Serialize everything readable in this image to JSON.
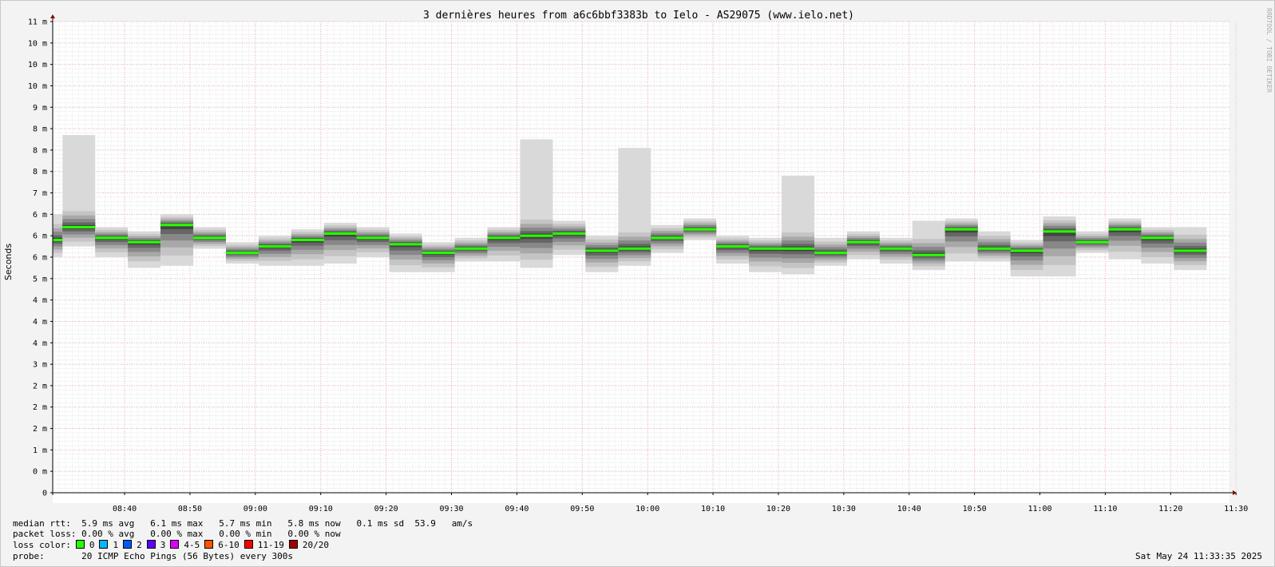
{
  "chart_data": {
    "type": "bar",
    "title": "3 dernières heures from a6c6bbf3383b to Ielo - AS29075 (www.ielo.net)",
    "ylabel": "Seconds",
    "xlabel": "",
    "y_unit": "ms",
    "ylim": [
      0,
      11
    ],
    "y_ticks": [
      {
        "v": 0,
        "label": "0"
      },
      {
        "v": 0.5,
        "label": "0 m"
      },
      {
        "v": 1.0,
        "label": "1 m"
      },
      {
        "v": 1.5,
        "label": "2 m"
      },
      {
        "v": 2.0,
        "label": "2 m"
      },
      {
        "v": 2.5,
        "label": "2 m"
      },
      {
        "v": 3.0,
        "label": "3 m"
      },
      {
        "v": 3.5,
        "label": "4 m"
      },
      {
        "v": 4.0,
        "label": "4 m"
      },
      {
        "v": 4.5,
        "label": "4 m"
      },
      {
        "v": 5.0,
        "label": "5 m"
      },
      {
        "v": 5.5,
        "label": "6 m"
      },
      {
        "v": 6.0,
        "label": "6 m"
      },
      {
        "v": 6.5,
        "label": "6 m"
      },
      {
        "v": 7.0,
        "label": "7 m"
      },
      {
        "v": 7.5,
        "label": "8 m"
      },
      {
        "v": 8.0,
        "label": "8 m"
      },
      {
        "v": 8.5,
        "label": "8 m"
      },
      {
        "v": 9.0,
        "label": "9 m"
      },
      {
        "v": 9.5,
        "label": "10 m"
      },
      {
        "v": 10.0,
        "label": "10 m"
      },
      {
        "v": 10.5,
        "label": "10 m"
      },
      {
        "v": 11.0,
        "label": "11 m"
      }
    ],
    "x_range_minutes": [
      0,
      180
    ],
    "x_ticks": [
      {
        "t": 11,
        "label": "08:40"
      },
      {
        "t": 21,
        "label": "08:50"
      },
      {
        "t": 31,
        "label": "09:00"
      },
      {
        "t": 41,
        "label": "09:10"
      },
      {
        "t": 51,
        "label": "09:20"
      },
      {
        "t": 61,
        "label": "09:30"
      },
      {
        "t": 71,
        "label": "09:40"
      },
      {
        "t": 81,
        "label": "09:50"
      },
      {
        "t": 91,
        "label": "10:00"
      },
      {
        "t": 101,
        "label": "10:10"
      },
      {
        "t": 111,
        "label": "10:20"
      },
      {
        "t": 121,
        "label": "10:30"
      },
      {
        "t": 131,
        "label": "10:40"
      },
      {
        "t": 141,
        "label": "10:50"
      },
      {
        "t": 151,
        "label": "11:00"
      },
      {
        "t": 161,
        "label": "11:10"
      },
      {
        "t": 171,
        "label": "11:20"
      },
      {
        "t": 181,
        "label": "11:30"
      }
    ],
    "grid": true,
    "series": [
      {
        "name": "median rtt",
        "columns": [
          {
            "t0": 0,
            "t1": 1.5,
            "median": 5.9,
            "min": 5.5,
            "max": 6.5,
            "loss": 0
          },
          {
            "t0": 1.5,
            "t1": 6.5,
            "median": 6.2,
            "min": 5.75,
            "max": 8.35,
            "loss": 0
          },
          {
            "t0": 6.5,
            "t1": 11.5,
            "median": 5.95,
            "min": 5.5,
            "max": 6.2,
            "loss": 0
          },
          {
            "t0": 11.5,
            "t1": 16.5,
            "median": 5.85,
            "min": 5.25,
            "max": 6.1,
            "loss": 0
          },
          {
            "t0": 16.5,
            "t1": 21.5,
            "median": 6.25,
            "min": 5.3,
            "max": 6.05,
            "loss": 0
          },
          {
            "t0": 21.5,
            "t1": 26.5,
            "median": 5.95,
            "min": 5.7,
            "max": 5.8,
            "loss": 0
          },
          {
            "t0": 26.5,
            "t1": 31.5,
            "median": 5.6,
            "min": 5.4,
            "max": 5.8,
            "loss": 0
          },
          {
            "t0": 31.5,
            "t1": 36.5,
            "median": 5.75,
            "min": 5.3,
            "max": 5.95,
            "loss": 0
          },
          {
            "t0": 36.5,
            "t1": 41.5,
            "median": 5.9,
            "min": 5.3,
            "max": 6.15,
            "loss": 0
          },
          {
            "t0": 41.5,
            "t1": 46.5,
            "median": 6.05,
            "min": 5.35,
            "max": 6.05,
            "loss": 0
          },
          {
            "t0": 46.5,
            "t1": 51.5,
            "median": 5.95,
            "min": 5.5,
            "max": 6.0,
            "loss": 0
          },
          {
            "t0": 51.5,
            "t1": 56.5,
            "median": 5.8,
            "min": 5.15,
            "max": 5.9,
            "loss": 0
          },
          {
            "t0": 56.5,
            "t1": 61.5,
            "median": 5.6,
            "min": 5.15,
            "max": 5.75,
            "loss": 0
          },
          {
            "t0": 61.5,
            "t1": 66.5,
            "median": 5.7,
            "min": 5.4,
            "max": 5.9,
            "loss": 0
          },
          {
            "t0": 66.5,
            "t1": 71.5,
            "median": 5.95,
            "min": 5.4,
            "max": 5.95,
            "loss": 0
          },
          {
            "t0": 71.5,
            "t1": 76.5,
            "median": 6.0,
            "min": 5.25,
            "max": 8.25,
            "loss": 0
          },
          {
            "t0": 76.5,
            "t1": 81.5,
            "median": 6.05,
            "min": 5.55,
            "max": 6.35,
            "loss": 0
          },
          {
            "t0": 81.5,
            "t1": 86.5,
            "median": 5.65,
            "min": 5.15,
            "max": 6.0,
            "loss": 0
          },
          {
            "t0": 86.5,
            "t1": 91.5,
            "median": 5.7,
            "min": 5.3,
            "max": 8.05,
            "loss": 0
          },
          {
            "t0": 91.5,
            "t1": 96.5,
            "median": 5.95,
            "min": 5.6,
            "max": 6.25,
            "loss": 0
          },
          {
            "t0": 96.5,
            "t1": 101.5,
            "median": 6.15,
            "min": 5.9,
            "max": 6.05,
            "loss": 0
          },
          {
            "t0": 101.5,
            "t1": 106.5,
            "median": 5.75,
            "min": 5.35,
            "max": 5.9,
            "loss": 0
          },
          {
            "t0": 106.5,
            "t1": 111.5,
            "median": 5.7,
            "min": 5.15,
            "max": 5.9,
            "loss": 0
          },
          {
            "t0": 111.5,
            "t1": 116.5,
            "median": 5.7,
            "min": 5.1,
            "max": 7.4,
            "loss": 0
          },
          {
            "t0": 116.5,
            "t1": 121.5,
            "median": 5.6,
            "min": 5.3,
            "max": 5.95,
            "loss": 0
          },
          {
            "t0": 121.5,
            "t1": 126.5,
            "median": 5.85,
            "min": 5.45,
            "max": 6.0,
            "loss": 0
          },
          {
            "t0": 126.5,
            "t1": 131.5,
            "median": 5.7,
            "min": 5.35,
            "max": 5.95,
            "loss": 0
          },
          {
            "t0": 131.5,
            "t1": 136.5,
            "median": 5.55,
            "min": 5.2,
            "max": 6.35,
            "loss": 0
          },
          {
            "t0": 136.5,
            "t1": 141.5,
            "median": 6.15,
            "min": 5.4,
            "max": 6.3,
            "loss": 0
          },
          {
            "t0": 141.5,
            "t1": 146.5,
            "median": 5.7,
            "min": 5.4,
            "max": 6.1,
            "loss": 0
          },
          {
            "t0": 146.5,
            "t1": 151.5,
            "median": 5.65,
            "min": 5.05,
            "max": 5.65,
            "loss": 0
          },
          {
            "t0": 151.5,
            "t1": 156.5,
            "median": 6.1,
            "min": 5.05,
            "max": 6.45,
            "loss": 0
          },
          {
            "t0": 156.5,
            "t1": 161.5,
            "median": 5.85,
            "min": 5.6,
            "max": 6.05,
            "loss": 0
          },
          {
            "t0": 161.5,
            "t1": 166.5,
            "median": 6.15,
            "min": 5.45,
            "max": 6.15,
            "loss": 0
          },
          {
            "t0": 166.5,
            "t1": 171.5,
            "median": 5.95,
            "min": 5.35,
            "max": 6.0,
            "loss": 0
          },
          {
            "t0": 171.5,
            "t1": 176.5,
            "median": 5.65,
            "min": 5.2,
            "max": 6.2,
            "loss": 0
          }
        ]
      }
    ]
  },
  "watermark": "RRDTOOL / TOBI OETIKER",
  "stats": {
    "median_rtt_label": "median rtt:",
    "median_rtt_values": "5.9 ms avg   6.1 ms max   5.7 ms min   5.8 ms now   0.1 ms sd  53.9   am/s",
    "packet_loss_label": "packet loss:",
    "packet_loss_values": "0.00 % avg   0.00 % max   0.00 % min   0.00 % now",
    "loss_color_label": "loss color:",
    "loss_colors": [
      {
        "label": "0",
        "color": "#26ff00"
      },
      {
        "label": "1",
        "color": "#00b8ff"
      },
      {
        "label": "2",
        "color": "#0059ff"
      },
      {
        "label": "3",
        "color": "#5e00ff"
      },
      {
        "label": "4-5",
        "color": "#dd00ff"
      },
      {
        "label": "6-10",
        "color": "#ff5500"
      },
      {
        "label": "11-19",
        "color": "#ff0000"
      },
      {
        "label": "20/20",
        "color": "#a10000"
      }
    ],
    "probe_label": "probe:",
    "probe_value": "20 ICMP Echo Pings (56 Bytes) every 300s"
  },
  "timestamp": "Sat May 24 11:33:35 2025"
}
